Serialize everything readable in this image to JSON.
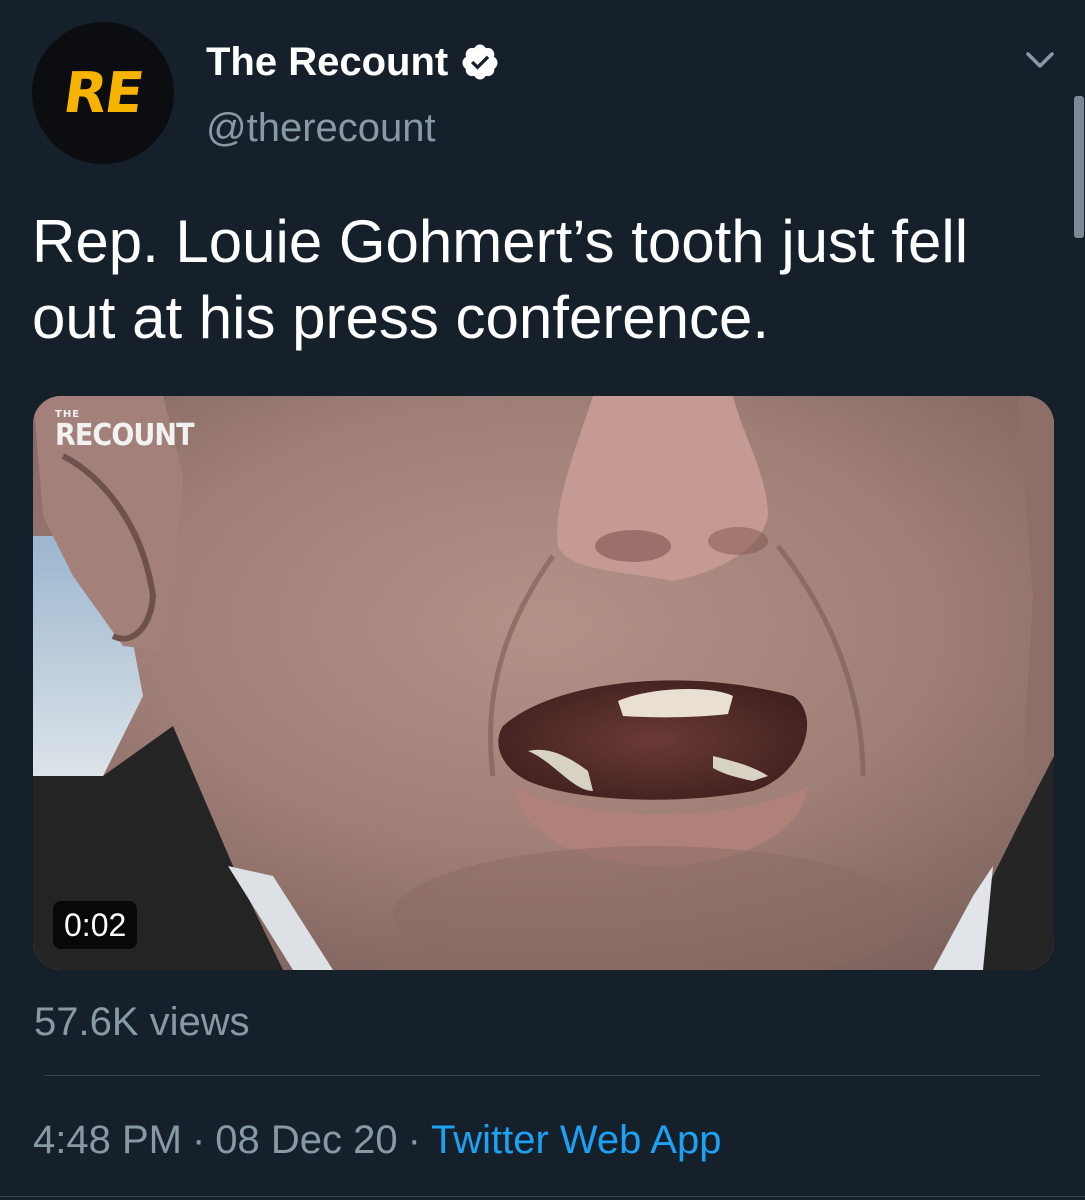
{
  "header": {
    "avatar_text": "RE",
    "display_name": "The Recount",
    "handle": "@therecount",
    "verified": true
  },
  "tweet": {
    "text": "Rep. Louie Gohmert’s tooth just fell out at his press conference."
  },
  "media": {
    "watermark_small": "THE",
    "watermark_large": "RECOUNT",
    "duration": "0:02"
  },
  "stats": {
    "views": "57.6K views"
  },
  "meta": {
    "time": "4:48 PM",
    "separator": "·",
    "date": "08 Dec 20",
    "source": "Twitter Web App"
  },
  "colors": {
    "background": "#15202b",
    "secondary_text": "#8899a6",
    "link": "#1da1f2",
    "avatar_accent": "#f6b400"
  },
  "icons": {
    "verified": "verified-badge-icon",
    "menu": "chevron-down-icon"
  }
}
